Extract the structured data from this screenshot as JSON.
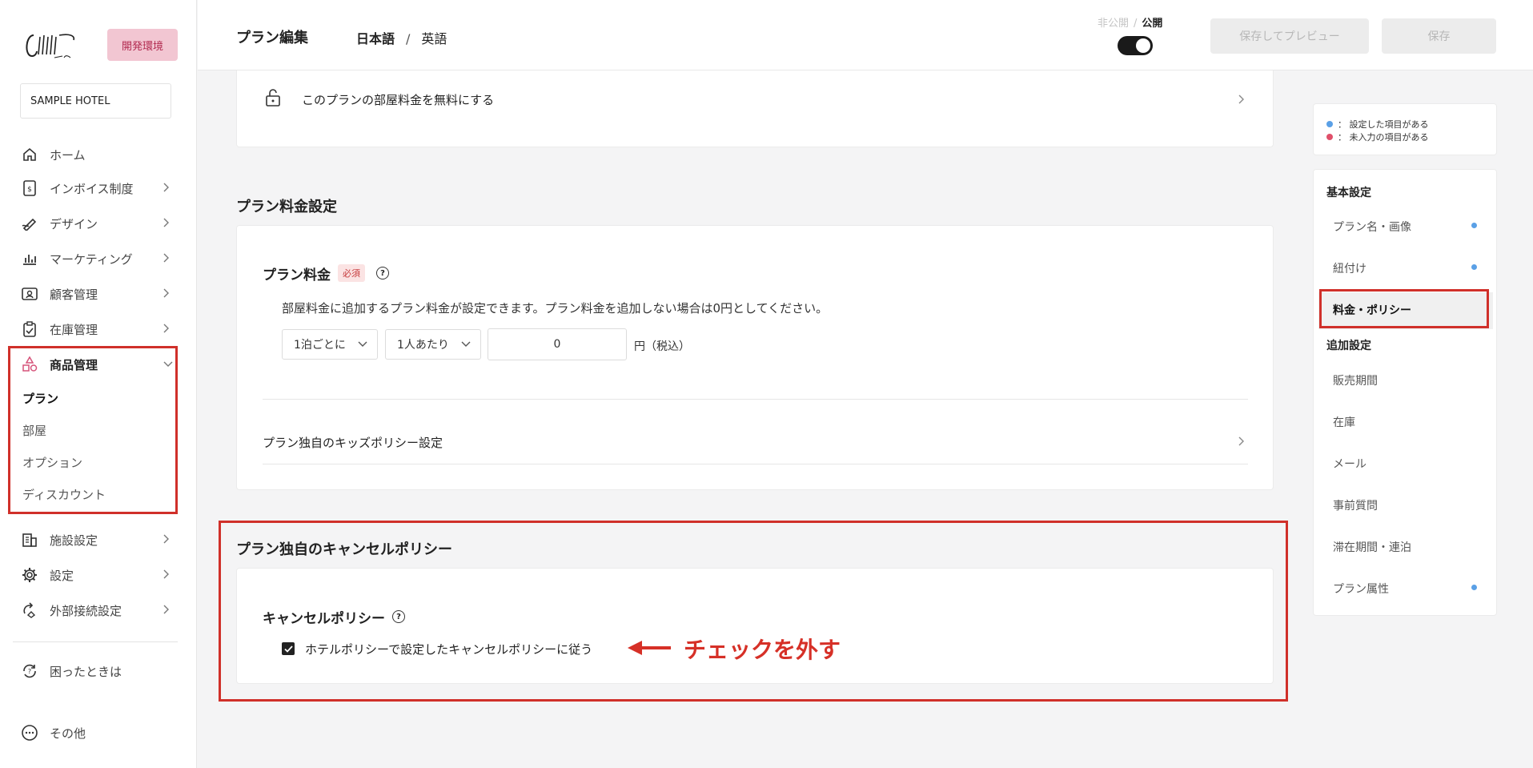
{
  "sidebar": {
    "env_badge": "開発環境",
    "hotel": "SAMPLE HOTEL",
    "items": [
      {
        "label": "ホーム"
      },
      {
        "label": "インボイス制度"
      },
      {
        "label": "デザイン"
      },
      {
        "label": "マーケティング"
      },
      {
        "label": "顧客管理"
      },
      {
        "label": "在庫管理"
      },
      {
        "label": "商品管理"
      },
      {
        "label": "施設設定"
      },
      {
        "label": "設定"
      },
      {
        "label": "外部接続設定"
      }
    ],
    "sub_items": [
      {
        "label": "プラン"
      },
      {
        "label": "部屋"
      },
      {
        "label": "オプション"
      },
      {
        "label": "ディスカウント"
      }
    ],
    "help": "困ったときは",
    "other": "その他"
  },
  "header": {
    "title": "プラン編集",
    "lang_ja": "日本語",
    "lang_sep": "/",
    "lang_en": "英語",
    "status_off": "非公開",
    "status_sep": "/",
    "status_on": "公開",
    "preview_button": "保存してプレビュー",
    "save_button": "保存"
  },
  "free_room": {
    "label": "このプランの部屋料金を無料にする"
  },
  "price_section": {
    "title": "プラン料金設定",
    "label": "プラン料金",
    "required": "必須",
    "description": "部屋料金に追加するプラン料金が設定できます。プラン料金を追加しない場合は0円としてください。",
    "per_night": "1泊ごとに",
    "per_person": "1人あたり",
    "amount": "0",
    "unit": "円（税込）",
    "kids_policy": "プラン独自のキッズポリシー設定"
  },
  "cancel_section": {
    "title": "プラン独自のキャンセルポリシー",
    "label": "キャンセルポリシー",
    "checkbox_label": "ホテルポリシーで設定したキャンセルポリシーに従う",
    "checked": true,
    "annotation": "チェックを外す"
  },
  "right_panel": {
    "legend_set": "： 設定した項目がある",
    "legend_missing": "： 未入力の項目がある",
    "group_basic": "基本設定",
    "basic_items": [
      {
        "label": "プラン名・画像",
        "dot": true
      },
      {
        "label": "紐付け",
        "dot": true
      },
      {
        "label": "料金・ポリシー",
        "dot": false
      }
    ],
    "group_extra": "追加設定",
    "extra_items": [
      {
        "label": "販売期間",
        "dot": false
      },
      {
        "label": "在庫",
        "dot": false
      },
      {
        "label": "メール",
        "dot": false
      },
      {
        "label": "事前質問",
        "dot": false
      },
      {
        "label": "滞在期間・連泊",
        "dot": false
      },
      {
        "label": "プラン属性",
        "dot": true
      }
    ]
  },
  "colors": {
    "annotation_red": "#d0302a",
    "dot_blue": "#5aa0e6",
    "dot_pink": "#e0506a",
    "env_badge_bg": "#f2c6d2"
  },
  "help_icon": "?"
}
